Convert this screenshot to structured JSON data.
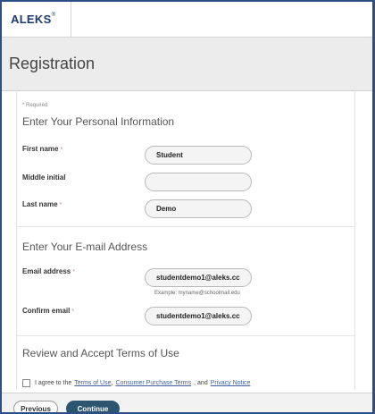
{
  "app": {
    "logo": "ALEKS",
    "logo_mark": "®"
  },
  "header": {
    "title": "Registration"
  },
  "form": {
    "required_note": "* Required",
    "personal_section": "Enter Your Personal Information",
    "email_section": "Enter Your E-mail Address",
    "terms_section": "Review and Accept Terms of Use",
    "required_marker": "*",
    "fields": {
      "first_name": {
        "label": "First name",
        "value": "Student"
      },
      "middle_initial": {
        "label": "Middle initial",
        "value": ""
      },
      "last_name": {
        "label": "Last name",
        "value": "Demo"
      },
      "email": {
        "label": "Email address",
        "value": "studentdemo1@aleks.cc",
        "hint": "Example: myname@schoolmail.edu"
      },
      "confirm_email": {
        "label": "Confirm email",
        "value": "studentdemo1@aleks.cc"
      }
    },
    "terms": {
      "prefix": "I agree to the",
      "terms_link": "Terms of Use",
      "sep1": ",",
      "purchase_link": "Consumer Purchase Terms",
      "sep2": ", and",
      "privacy_link": "Privacy Notice",
      "checked": false
    }
  },
  "footer": {
    "previous_label": "Previous",
    "continue_label": "Continue"
  },
  "colors": {
    "frame": "#2d4f86",
    "accent": "#2c5570",
    "link": "#3f5fa0"
  }
}
